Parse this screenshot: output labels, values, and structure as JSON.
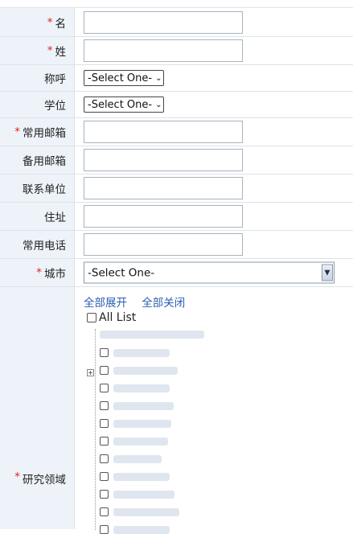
{
  "fields": {
    "first_name": {
      "label": "名",
      "required": true,
      "value": ""
    },
    "last_name": {
      "label": "姓",
      "required": true,
      "value": ""
    },
    "title": {
      "label": "称呼",
      "selected": "-Select One-"
    },
    "degree": {
      "label": "学位",
      "selected": "-Select One-"
    },
    "email": {
      "label": "常用邮箱",
      "required": true,
      "value": ""
    },
    "alt_email": {
      "label": "备用邮箱",
      "value": ""
    },
    "organization": {
      "label": "联系单位",
      "value": ""
    },
    "address": {
      "label": "住址",
      "value": ""
    },
    "phone": {
      "label": "常用电话",
      "value": ""
    },
    "city": {
      "label": "城市",
      "required": true,
      "selected": "-Select One-"
    },
    "research": {
      "label": "研究领域",
      "required": true,
      "expand_all": "全部展开",
      "collapse_all": "全部关闭",
      "all_list": "All List"
    }
  },
  "required_mark": "*",
  "icons": {
    "select_arrow": "chevron-down-icon",
    "tree_toggle": "plus-icon"
  },
  "colors": {
    "label_bg": "#eef3f9",
    "required": "#e02020",
    "link": "#2a5db0"
  }
}
